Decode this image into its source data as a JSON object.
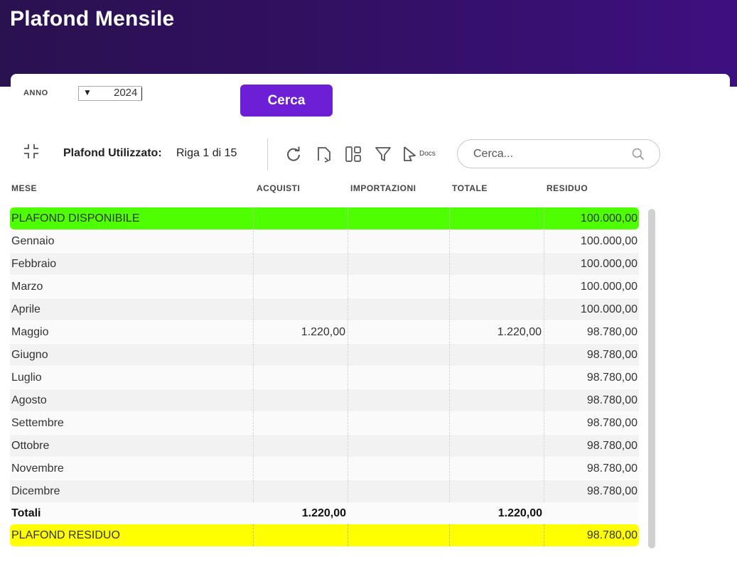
{
  "page": {
    "title": "Plafond Mensile"
  },
  "filter": {
    "anno_label": "ANNO",
    "anno_value": "2024",
    "dropdown_arrow": "▼",
    "search_button_label": "Cerca"
  },
  "toolbar": {
    "title": "Plafond Utilizzato:",
    "row_info": "Riga 1 di 15",
    "docs_label": "Docs",
    "search_placeholder": "Cerca...",
    "icons": [
      "collapse-icon",
      "refresh-icon",
      "export-icon",
      "columns-icon",
      "filter-icon",
      "docs-icon",
      "search-icon"
    ]
  },
  "grid": {
    "columns": [
      "MESE",
      "ACQUISTI",
      "IMPORTAZIONI",
      "TOTALE",
      "RESIDUO"
    ],
    "rows": [
      {
        "mese": "PLAFOND DISPONIBILE",
        "acquisti": "",
        "importazioni": "",
        "totale": "",
        "residuo": "100.000,00"
      },
      {
        "mese": "Gennaio",
        "acquisti": "",
        "importazioni": "",
        "totale": "",
        "residuo": "100.000,00"
      },
      {
        "mese": "Febbraio",
        "acquisti": "",
        "importazioni": "",
        "totale": "",
        "residuo": "100.000,00"
      },
      {
        "mese": "Marzo",
        "acquisti": "",
        "importazioni": "",
        "totale": "",
        "residuo": "100.000,00"
      },
      {
        "mese": "Aprile",
        "acquisti": "",
        "importazioni": "",
        "totale": "",
        "residuo": "100.000,00"
      },
      {
        "mese": "Maggio",
        "acquisti": "1.220,00",
        "importazioni": "",
        "totale": "1.220,00",
        "residuo": "98.780,00"
      },
      {
        "mese": "Giugno",
        "acquisti": "",
        "importazioni": "",
        "totale": "",
        "residuo": "98.780,00"
      },
      {
        "mese": "Luglio",
        "acquisti": "",
        "importazioni": "",
        "totale": "",
        "residuo": "98.780,00"
      },
      {
        "mese": "Agosto",
        "acquisti": "",
        "importazioni": "",
        "totale": "",
        "residuo": "98.780,00"
      },
      {
        "mese": "Settembre",
        "acquisti": "",
        "importazioni": "",
        "totale": "",
        "residuo": "98.780,00"
      },
      {
        "mese": "Ottobre",
        "acquisti": "",
        "importazioni": "",
        "totale": "",
        "residuo": "98.780,00"
      },
      {
        "mese": "Novembre",
        "acquisti": "",
        "importazioni": "",
        "totale": "",
        "residuo": "98.780,00"
      },
      {
        "mese": "Dicembre",
        "acquisti": "",
        "importazioni": "",
        "totale": "",
        "residuo": "98.780,00"
      },
      {
        "mese": "Totali",
        "acquisti": "1.220,00",
        "importazioni": "",
        "totale": "1.220,00",
        "residuo": ""
      },
      {
        "mese": "PLAFOND RESIDUO",
        "acquisti": "",
        "importazioni": "",
        "totale": "",
        "residuo": "98.780,00"
      }
    ]
  },
  "colors": {
    "header_gradient_start": "#2a1150",
    "header_gradient_end": "#3d1080",
    "button": "#6d1fd6",
    "row_disponibile": "#4dff00",
    "row_residuo": "#ffff00"
  }
}
